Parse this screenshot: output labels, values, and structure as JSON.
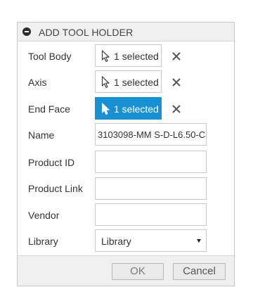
{
  "dialog": {
    "title": "ADD TOOL HOLDER"
  },
  "fields": {
    "tool_body": {
      "label": "Tool Body",
      "value": "1 selected"
    },
    "axis": {
      "label": "Axis",
      "value": "1 selected"
    },
    "end_face": {
      "label": "End Face",
      "value": "1 selected"
    },
    "name": {
      "label": "Name",
      "value": "3103098-MM S-D-L6.50-C"
    },
    "product_id": {
      "label": "Product ID",
      "value": ""
    },
    "product_link": {
      "label": "Product Link",
      "value": ""
    },
    "vendor": {
      "label": "Vendor",
      "value": ""
    },
    "library": {
      "label": "Library",
      "value": "Library"
    }
  },
  "buttons": {
    "ok": "OK",
    "cancel": "Cancel"
  },
  "colors": {
    "active_selection": "#1890d4",
    "panel_background": "#f0f0f0",
    "border": "#c9c9c9"
  },
  "icons": {
    "collapse": "minus-circle-icon",
    "cursor": "select-cursor-icon",
    "clear": "close-x-icon",
    "dropdown": "caret-down-icon"
  }
}
